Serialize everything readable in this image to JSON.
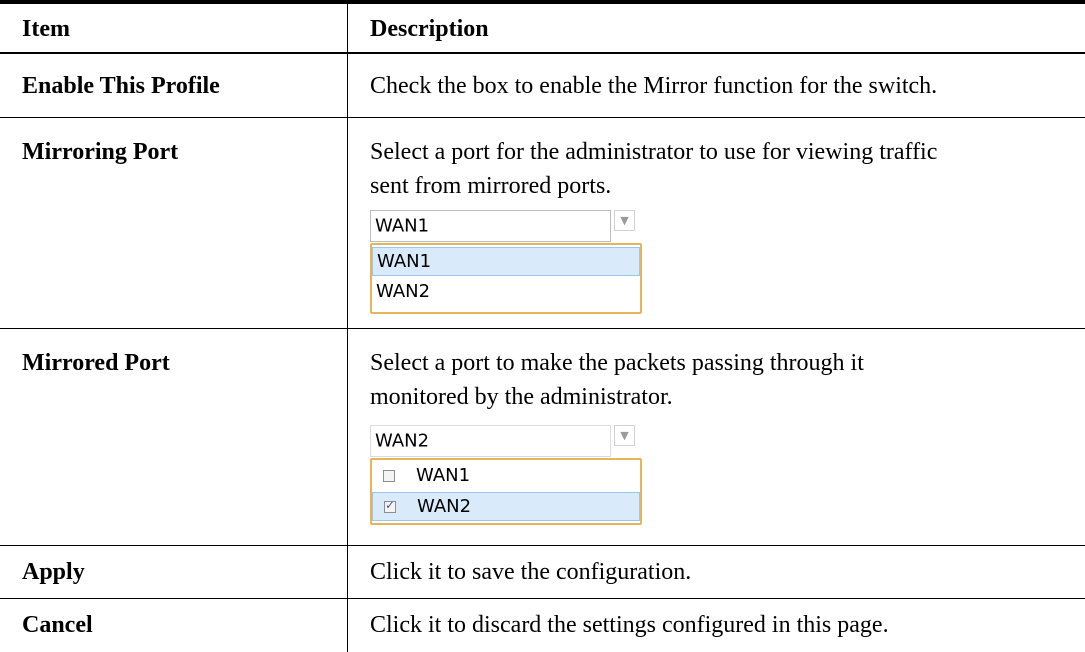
{
  "header": {
    "item": "Item",
    "description": "Description"
  },
  "rows": [
    {
      "item": "Enable This Profile",
      "description_lines": [
        "Check the box to enable the Mirror function for the switch."
      ]
    },
    {
      "item": "Mirroring Port",
      "description_lines": [
        "Select a port for the administrator to use for viewing traffic",
        "sent from mirrored ports."
      ],
      "dropdown": {
        "selected": "WAN1",
        "options": [
          "WAN1",
          "WAN2"
        ],
        "highlighted": "WAN1"
      }
    },
    {
      "item": "Mirrored Port",
      "description_lines": [
        "Select a port to make the packets passing through it",
        "monitored by the administrator."
      ],
      "dropdown": {
        "selected": "WAN2",
        "options": [
          {
            "label": "WAN1",
            "checked": false
          },
          {
            "label": "WAN2",
            "checked": true
          }
        ],
        "highlighted": "WAN2"
      }
    },
    {
      "item": "Apply",
      "description_lines": [
        "Click it to save the configuration."
      ]
    },
    {
      "item": "Cancel",
      "description_lines": [
        "Click it to discard the settings configured in this page."
      ]
    }
  ],
  "icons": {
    "dropdown": "chevron-down-icon",
    "check": "checkmark-icon"
  },
  "colors": {
    "focus_border": "#e8b45a",
    "highlight": "#d9ebfa",
    "rule": "#000000"
  }
}
